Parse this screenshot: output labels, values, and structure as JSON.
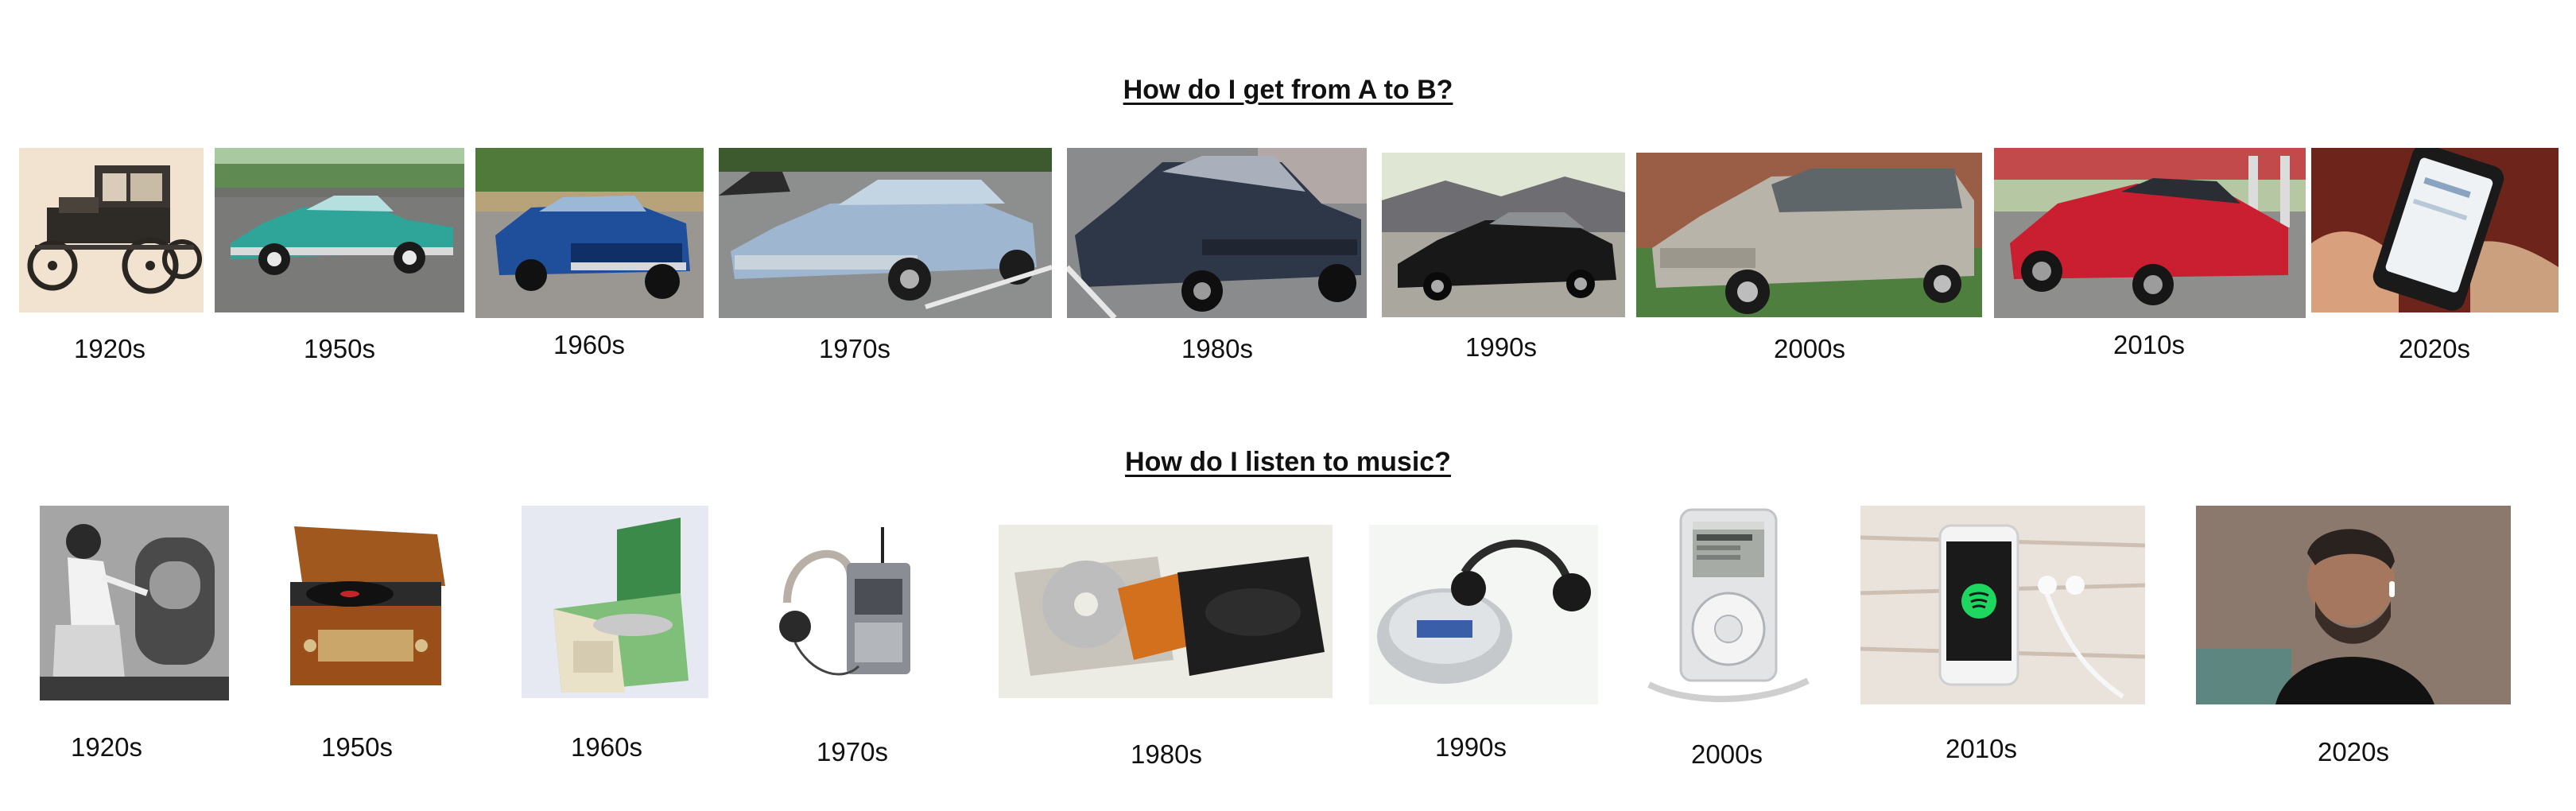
{
  "transport": {
    "title": "How do I get from A to B?",
    "items": [
      {
        "label": "1920s",
        "icon": "ford-model-t-photo"
      },
      {
        "label": "1950s",
        "icon": "chevrolet-bel-air-photo"
      },
      {
        "label": "1960s",
        "icon": "muscle-car-photo"
      },
      {
        "label": "1970s",
        "icon": "buick-sedan-photo"
      },
      {
        "label": "1980s",
        "icon": "ford-taurus-photo"
      },
      {
        "label": "1990s",
        "icon": "honda-accord-photo"
      },
      {
        "label": "2000s",
        "icon": "minivan-photo"
      },
      {
        "label": "2010s",
        "icon": "tesla-model-s-photo"
      },
      {
        "label": "2020s",
        "icon": "smartphone-ride-app-photo"
      }
    ]
  },
  "music": {
    "title": "How do I listen to music?",
    "items": [
      {
        "label": "1920s",
        "icon": "radio-listener-photo"
      },
      {
        "label": "1950s",
        "icon": "record-player-photo"
      },
      {
        "label": "1960s",
        "icon": "portable-turntable-photo"
      },
      {
        "label": "1970s",
        "icon": "walkman-headphones-photo"
      },
      {
        "label": "1980s",
        "icon": "cd-player-photo"
      },
      {
        "label": "1990s",
        "icon": "discman-photo"
      },
      {
        "label": "2000s",
        "icon": "ipod-photo"
      },
      {
        "label": "2010s",
        "icon": "iphone-spotify-photo"
      },
      {
        "label": "2020s",
        "icon": "airpods-listener-photo"
      }
    ]
  }
}
